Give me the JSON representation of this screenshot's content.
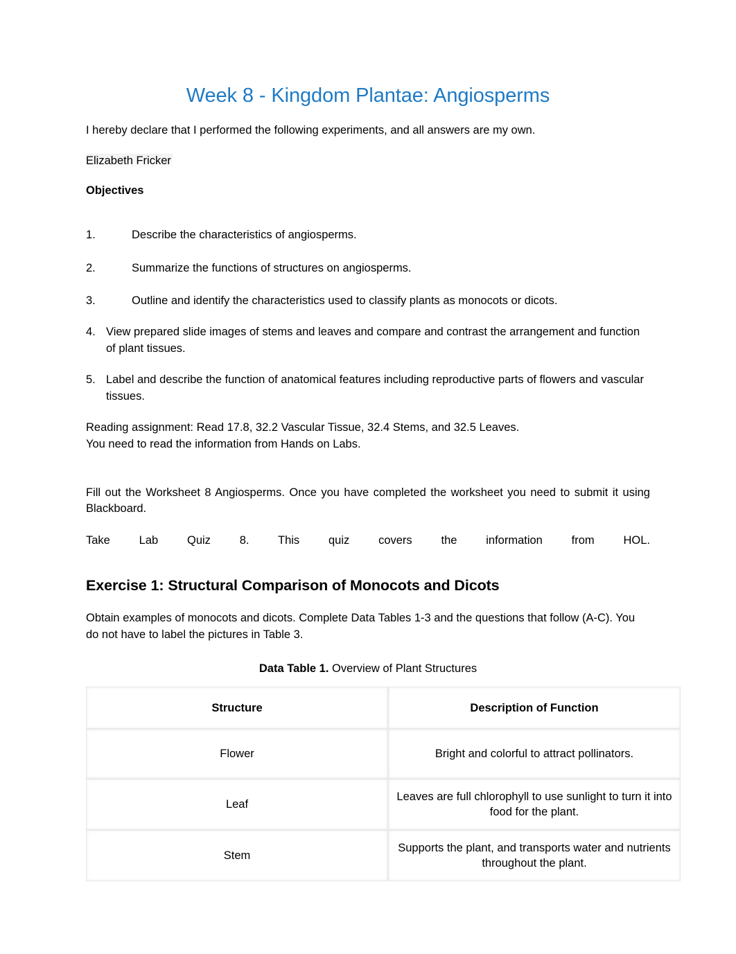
{
  "document": {
    "title": "Week 8 - Kingdom Plantae: Angiosperms",
    "title_color": "#1F7AC4",
    "declaration": "I hereby declare that I performed the following experiments, and all answers are my own.",
    "student_name": "Elizabeth Fricker",
    "objectives_heading": "Objectives",
    "objectives": [
      {
        "number": "1.",
        "text": "Describe the characteristics of angiosperms."
      },
      {
        "number": "2.",
        "text": "Summarize the functions of structures on angiosperms."
      },
      {
        "number": "3.",
        "text": "Outline and identify the characteristics used to classify plants as monocots or dicots."
      },
      {
        "number": "4.",
        "text": "View prepared slide images of stems and leaves and compare and contrast the arrangement and function of plant tissues."
      },
      {
        "number": "5.",
        "text": "Label and describe the function of anatomical features including reproductive parts of flowers and vascular tissues."
      }
    ],
    "reading_assignment_line1": "Reading assignment: Read 17.8, 32.2 Vascular Tissue, 32.4 Stems, and 32.5 Leaves.",
    "reading_assignment_line2": "You need to read the information from Hands on Labs.",
    "worksheet_instruction": "Fill out the Worksheet 8 Angiosperms. Once you have completed the worksheet you need to submit it using Blackboard.",
    "quiz_instruction": "Take Lab Quiz 8. This quiz covers the information from HOL."
  },
  "exercise1": {
    "heading": "Exercise 1: Structural Comparison of Monocots and Dicots",
    "instructions": "Obtain examples of monocots and dicots. Complete Data Tables 1-3 and the questions that follow (A-C). You do not have to label the pictures in Table 3.",
    "table_caption_bold": "Data Table 1.",
    "table_caption_rest": " Overview of Plant Structures",
    "table": {
      "headers": [
        "Structure",
        "Description of Function"
      ],
      "rows": [
        {
          "structure": "Flower",
          "description": "Bright and colorful to attract pollinators."
        },
        {
          "structure": "Leaf",
          "description": "Leaves are full chlorophyll to use sunlight to turn it into food for the plant."
        },
        {
          "structure": "Stem",
          "description": "Supports the plant, and transports water and nutrients throughout the plant."
        }
      ]
    }
  }
}
